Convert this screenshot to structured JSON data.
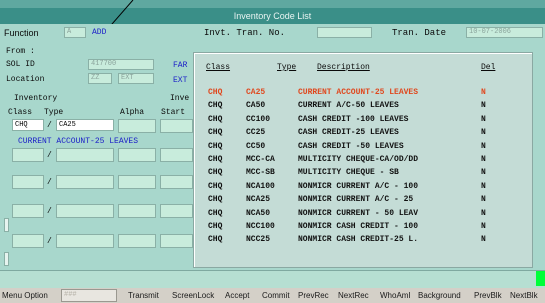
{
  "window": {
    "title": "Inventory Code List"
  },
  "header": {
    "function_label": "Function",
    "function_value": "A",
    "function_mode": "ADD",
    "invt_tran_no_label": "Invt. Tran. No.",
    "tran_date_label": "Tran. Date",
    "tran_date_value": "10-07-2006"
  },
  "form": {
    "from_label": "From :",
    "sol_id_label": "SOL ID",
    "sol_id_value": "417700",
    "location_label": "Location",
    "location_code1": "ZZ",
    "location_code2": "EXT",
    "far_label": "FAR",
    "ext_label": "EXT",
    "inventory_label": "Inventory",
    "inv_label2": "Inve",
    "class_label": "Class",
    "type_label": "Type",
    "alpha_label": "Alpha",
    "start_label": "Start",
    "class_value": "CHQ",
    "type_value": "CA25",
    "description_value": "CURRENT ACCOUNT-25 LEAVES"
  },
  "popup": {
    "headers": {
      "class": "Class",
      "type": "Type",
      "description": "Description",
      "del": "Del"
    },
    "rows": [
      {
        "class": "CHQ",
        "type": "CA25",
        "description": "CURRENT ACCOUNT-25 LEAVES",
        "del": "N",
        "selected": true
      },
      {
        "class": "CHQ",
        "type": "CA50",
        "description": "CURRENT A/C-50 LEAVES",
        "del": "N"
      },
      {
        "class": "CHQ",
        "type": "CC100",
        "description": "CASH CREDIT -100 LEAVES",
        "del": "N"
      },
      {
        "class": "CHQ",
        "type": "CC25",
        "description": "CASH CREDIT-25 LEAVES",
        "del": "N"
      },
      {
        "class": "CHQ",
        "type": "CC50",
        "description": "CASH CREDIT -50 LEAVES",
        "del": "N"
      },
      {
        "class": "CHQ",
        "type": "MCC-CA",
        "description": "MULTICITY CHEQUE-CA/OD/DD",
        "del": "N"
      },
      {
        "class": "CHQ",
        "type": "MCC-SB",
        "description": "MULTICITY CHEQUE - SB",
        "del": "N"
      },
      {
        "class": "CHQ",
        "type": "NCA100",
        "description": "NONMICR CURRENT A/C - 100",
        "del": "N"
      },
      {
        "class": "CHQ",
        "type": "NCA25",
        "description": "NONMICR CURRENT A/C - 25",
        "del": "N"
      },
      {
        "class": "CHQ",
        "type": "NCA50",
        "description": "NONMICR CURRENT - 50 LEAV",
        "del": "N"
      },
      {
        "class": "CHQ",
        "type": "NCC100",
        "description": "NONMICR CASH CREDIT - 100",
        "del": "N"
      },
      {
        "class": "CHQ",
        "type": "NCC25",
        "description": "NONMICR CASH CREDIT-25 L.",
        "del": "N"
      }
    ]
  },
  "menu": {
    "menu_option_label": "Menu Option",
    "menu_option_value": "###",
    "buttons": [
      "Transmit",
      "ScreenLock",
      "Accept",
      "Commit",
      "PrevRec",
      "NextRec",
      "WhoAmI",
      "Background",
      "PrevBlk",
      "NextBlk"
    ]
  },
  "colors": {
    "selected_row": "#e0481e",
    "accent_blue": "#1d20c8",
    "indicator_green": "#00ff3a"
  }
}
